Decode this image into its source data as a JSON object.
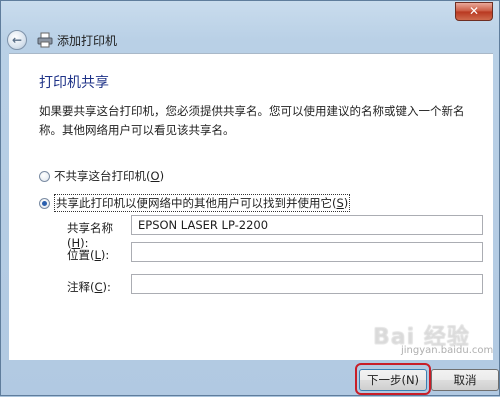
{
  "window": {
    "title": "添加打印机",
    "close_glyph": "✕"
  },
  "page": {
    "heading": "打印机共享",
    "description": "如果要共享这台打印机，您必须提供共享名。您可以使用建议的名称或键入一个新名称。其他网络用户可以看见该共享名。"
  },
  "options": {
    "no_share": {
      "label": "不共享这台打印机(",
      "key": "O",
      "suffix": ")",
      "selected": false
    },
    "share": {
      "label": "共享此打印机以便网络中的其他用户可以找到并使用它(",
      "key": "S",
      "suffix": ")",
      "selected": true
    }
  },
  "fields": {
    "share_name": {
      "label": "共享名称(",
      "key": "H",
      "suffix": "):",
      "value": "EPSON LASER LP-2200"
    },
    "location": {
      "label": "位置(",
      "key": "L",
      "suffix": "):",
      "value": ""
    },
    "comment": {
      "label": "注释(",
      "key": "C",
      "suffix": "):",
      "value": ""
    }
  },
  "buttons": {
    "next": "下一步(N)",
    "cancel": "取消"
  },
  "watermark": {
    "brand": "Bai 经验",
    "url": "jingyan.baidu.com"
  },
  "colors": {
    "heading": "#1e3287",
    "highlight": "#c81e28"
  }
}
